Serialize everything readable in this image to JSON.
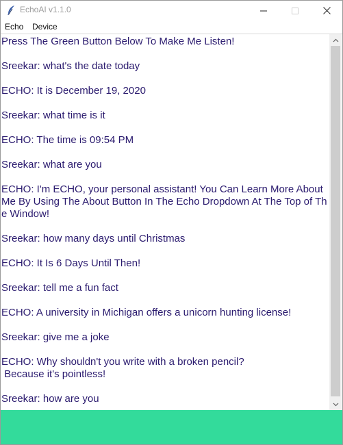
{
  "window": {
    "title": "EchoAI v1.1.0"
  },
  "menu": {
    "items": [
      "Echo",
      "Device"
    ]
  },
  "chat": {
    "messages": [
      "Press The Green Button Below To Make Me Listen!",
      "Sreekar: what's the date today",
      "ECHO: It is December 19, 2020",
      "Sreekar: what time is it",
      "ECHO: The time is 09:54 PM",
      "Sreekar: what are you",
      "ECHO: I'm ECHO, your personal assistant! You Can Learn More About Me By Using The About Button In The Echo Dropdown At The Top of The Window!",
      "Sreekar: how many days until Christmas",
      "ECHO: It Is 6 Days Until Then!",
      "Sreekar: tell me a fun fact",
      "ECHO: A university in Michigan offers a unicorn hunting license!",
      "Sreekar: give me a joke",
      "ECHO: Why shouldn't you write with a broken pencil?\n Because it's pointless!",
      "Sreekar: how are you"
    ]
  },
  "listen_button": {
    "color": "#33db9b"
  },
  "colors": {
    "text": "#2a1a6e"
  }
}
